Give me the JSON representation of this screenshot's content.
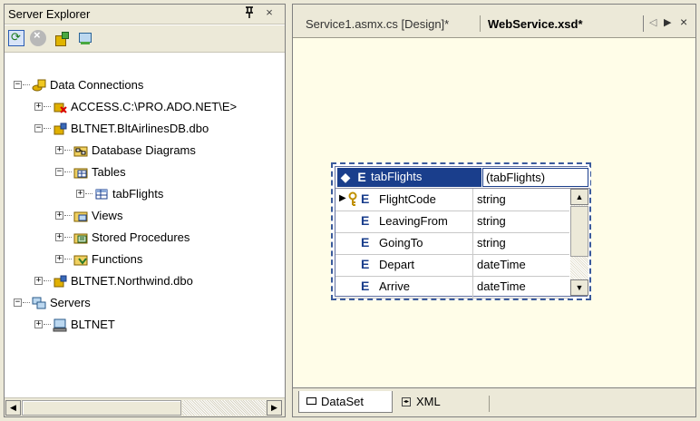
{
  "server_explorer": {
    "title": "Server Explorer",
    "pin_glyph": "ᵽ",
    "close_glyph": "×",
    "tree": [
      {
        "label": "Data Connections",
        "indent": 0,
        "expander": "−",
        "icon": "data-connections-icon"
      },
      {
        "label": "ACCESS.C:\\PRO.ADO.NET\\E>",
        "indent": 1,
        "expander": "+",
        "icon": "broken-connection-icon"
      },
      {
        "label": "BLTNET.BltAirlinesDB.dbo",
        "indent": 1,
        "expander": "−",
        "icon": "database-connection-icon"
      },
      {
        "label": "Database Diagrams",
        "indent": 2,
        "expander": "+",
        "icon": "diagram-folder-icon"
      },
      {
        "label": "Tables",
        "indent": 2,
        "expander": "−",
        "icon": "tables-folder-icon"
      },
      {
        "label": "tabFlights",
        "indent": 3,
        "expander": "+",
        "icon": "table-icon"
      },
      {
        "label": "Views",
        "indent": 2,
        "expander": "+",
        "icon": "views-folder-icon"
      },
      {
        "label": "Stored Procedures",
        "indent": 2,
        "expander": "+",
        "icon": "stored-procedures-folder-icon"
      },
      {
        "label": "Functions",
        "indent": 2,
        "expander": "+",
        "icon": "functions-folder-icon"
      },
      {
        "label": "BLTNET.Northwind.dbo",
        "indent": 1,
        "expander": "+",
        "icon": "database-connection-icon"
      },
      {
        "label": "Servers",
        "indent": 0,
        "expander": "−",
        "icon": "servers-icon"
      },
      {
        "label": "BLTNET",
        "indent": 1,
        "expander": "+",
        "icon": "server-icon"
      }
    ]
  },
  "designer": {
    "tabs": [
      {
        "label": "Service1.asmx.cs [Design]*",
        "active": false
      },
      {
        "label": "WebService.xsd*",
        "active": true
      }
    ],
    "element": {
      "name": "tabFlights",
      "type": "(tabFlights)",
      "rows": [
        {
          "name": "FlightCode",
          "type": "string",
          "key": true,
          "selected": true
        },
        {
          "name": "LeavingFrom",
          "type": "string",
          "key": false,
          "selected": false
        },
        {
          "name": "GoingTo",
          "type": "string",
          "key": false,
          "selected": false
        },
        {
          "name": "Depart",
          "type": "dateTime",
          "key": false,
          "selected": false
        },
        {
          "name": "Arrive",
          "type": "dateTime",
          "key": false,
          "selected": false
        }
      ]
    },
    "bottom_tabs": [
      {
        "label": "DataSet",
        "active": true
      },
      {
        "label": "XML",
        "active": false
      }
    ]
  },
  "colors": {
    "chrome": "#ece9d8",
    "canvas": "#fffde8",
    "header_blue": "#1a3e8c"
  }
}
